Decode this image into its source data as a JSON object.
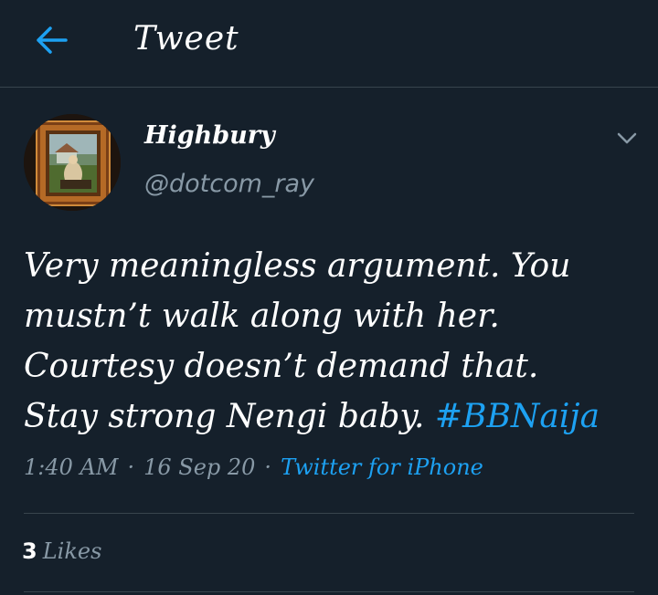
{
  "header": {
    "title": "Tweet",
    "back_icon": "arrow-left-icon"
  },
  "tweet": {
    "author": {
      "display_name": "Highbury",
      "handle": "@dotcom_ray",
      "avatar_icon": "framed-painting-avatar"
    },
    "text_lines": [
      "Very meaningless argument. You",
      "mustn’t walk along with her.",
      "Courtesy doesn’t demand that.",
      "Stay strong Nengi baby. "
    ],
    "hashtag": "#BBNaija",
    "time": "1:40 AM",
    "separator": "·",
    "date": "16 Sep 20",
    "source": "Twitter for iPhone",
    "likes_count": "3",
    "likes_label": "Likes"
  },
  "colors": {
    "background": "#15202b",
    "accent": "#1da1f2",
    "secondary_text": "#8899a6",
    "divider": "#38444d"
  }
}
